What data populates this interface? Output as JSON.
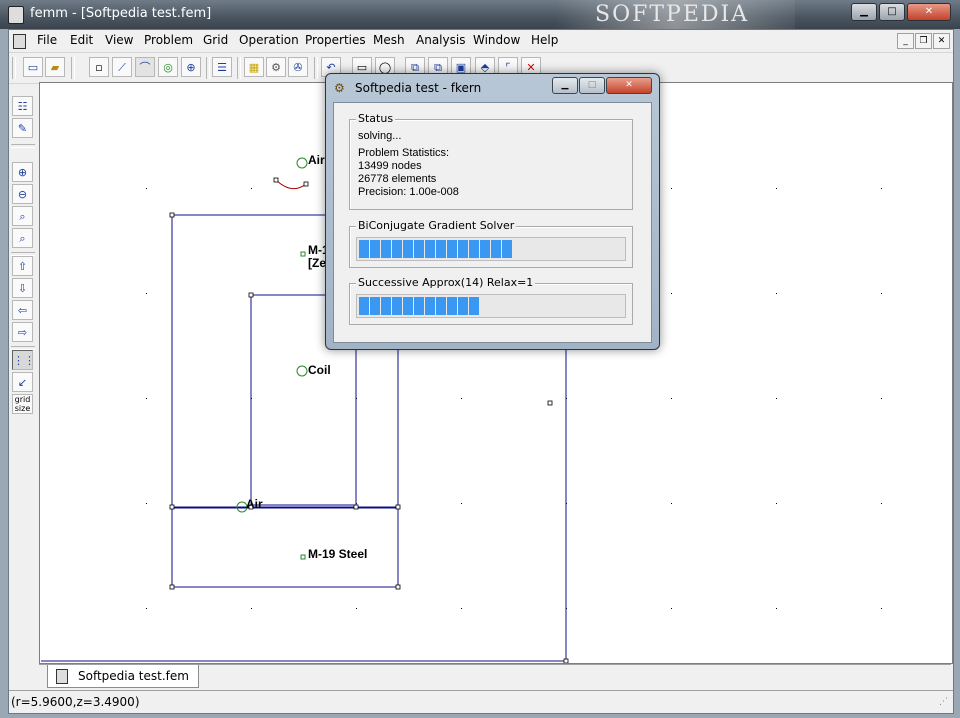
{
  "window": {
    "title": "femm - [Softpedia test.fem]",
    "watermark": "SOFTPEDIA",
    "buttons": {
      "minimize": "▁",
      "maximize": "□",
      "close": "✕"
    }
  },
  "menubar": {
    "items": [
      "File",
      "Edit",
      "View",
      "Problem",
      "Grid",
      "Operation",
      "Properties",
      "Mesh",
      "Analysis",
      "Window",
      "Help"
    ]
  },
  "canvas": {
    "labels": {
      "air_top": "Air",
      "m19_zeta_1": "M-1",
      "m19_zeta_2": "[Ze",
      "coil": "Coil",
      "air_mid": "Air",
      "m19_steel": "M-19 Steel"
    },
    "colors": {
      "lines": "#0c0c8a",
      "arc": "#b00000",
      "marker": "#2a8a2a"
    }
  },
  "tab": {
    "label": "Softpedia test.fem"
  },
  "status": {
    "coords": "(r=5.9600,z=3.4900)"
  },
  "left_toolbar": {
    "grid_size_label_1": "grid",
    "grid_size_label_2": "size"
  },
  "dialog": {
    "title": "Softpedia test - fkern",
    "status_group": "Status",
    "status_text": "solving...",
    "stats_heading": "Problem Statistics:",
    "nodes": "13499 nodes",
    "elements": "26778 elements",
    "precision": "Precision: 1.00e-008",
    "solver_group": "BiConjugate Gradient Solver",
    "solver_progress": 0.57,
    "approx_group": "Successive Approx(14) Relax=1",
    "approx_progress": 0.47,
    "progress_color": "#3b98f2"
  }
}
